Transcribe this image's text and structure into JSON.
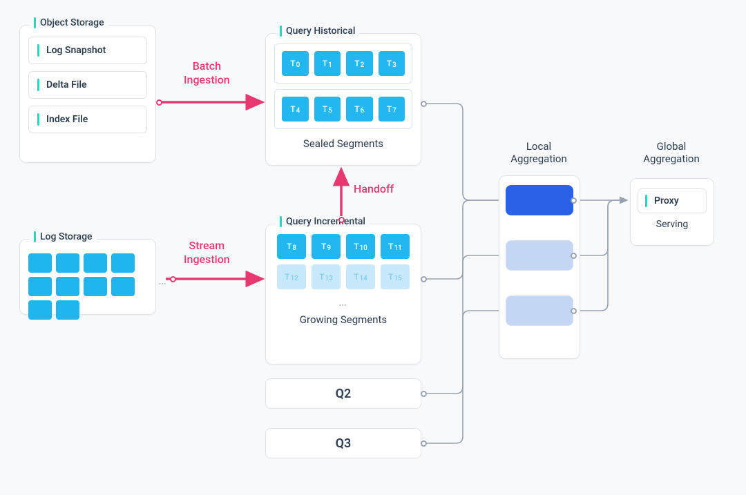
{
  "object_storage": {
    "title": "Object Storage",
    "files": [
      "Log Snapshot",
      "Delta File",
      "Index File"
    ]
  },
  "log_storage": {
    "title": "Log Storage",
    "blocks": 10
  },
  "query_historical": {
    "title": "Query Historical",
    "row1": [
      "T0",
      "T1",
      "T2",
      "T3"
    ],
    "row2": [
      "T4",
      "T5",
      "T6",
      "T7"
    ],
    "caption": "Sealed Segments"
  },
  "query_incremental": {
    "title": "Query Incremental",
    "row1": [
      "T8",
      "T9",
      "T10",
      "T11"
    ],
    "row2": [
      "T12",
      "T13",
      "T14",
      "T15"
    ],
    "caption": "Growing Segments"
  },
  "flow_labels": {
    "batch": "Batch\nIngestion",
    "stream": "Stream\nIngestion",
    "handoff": "Handoff"
  },
  "extra_queries": [
    "Q2",
    "Q3"
  ],
  "aggregation": {
    "local_label": "Local\nAggregation",
    "global_label": "Global\nAggregation"
  },
  "serving": {
    "proxy_label": "Proxy",
    "caption": "Serving"
  },
  "colors": {
    "cyan": "#22b8ef",
    "pink": "#e63972",
    "blue_dark": "#2962e6",
    "blue_light": "#b7cff2"
  }
}
